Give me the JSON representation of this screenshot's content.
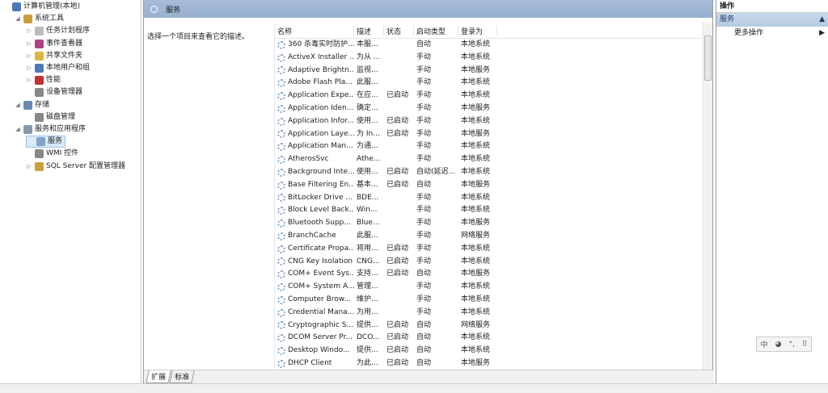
{
  "tree": [
    {
      "label": "计算机管理(本地)",
      "level": 0,
      "arrow": "",
      "color": "#4a7ab5"
    },
    {
      "label": "系统工具",
      "level": 1,
      "arrow": "◢",
      "color": "#c9a040"
    },
    {
      "label": "任务计划程序",
      "level": 2,
      "arrow": "▷",
      "color": "#bbbbbb"
    },
    {
      "label": "事件查看器",
      "level": 2,
      "arrow": "▷",
      "color": "#b04080"
    },
    {
      "label": "共享文件夹",
      "level": 2,
      "arrow": "▷",
      "color": "#d9b840"
    },
    {
      "label": "本地用户和组",
      "level": 2,
      "arrow": "▷",
      "color": "#4a7ab5"
    },
    {
      "label": "性能",
      "level": 2,
      "arrow": "▷",
      "color": "#c03030"
    },
    {
      "label": "设备管理器",
      "level": 2,
      "arrow": "",
      "color": "#888888"
    },
    {
      "label": "存储",
      "level": 1,
      "arrow": "◢",
      "color": "#6a8ab0"
    },
    {
      "label": "磁盘管理",
      "level": 2,
      "arrow": "",
      "color": "#888888"
    },
    {
      "label": "服务和应用程序",
      "level": 1,
      "arrow": "◢",
      "color": "#8899aa"
    },
    {
      "label": "服务",
      "level": 2,
      "arrow": "",
      "color": "#7fa5cc",
      "selected": true
    },
    {
      "label": "WMI 控件",
      "level": 2,
      "arrow": "",
      "color": "#888888"
    },
    {
      "label": "SQL Server 配置管理器",
      "level": 2,
      "arrow": "▷",
      "color": "#c9a040"
    }
  ],
  "middle": {
    "title": "服务",
    "description_hint": "选择一个项目来查看它的描述。",
    "columns": [
      "名称",
      "描述",
      "状态",
      "启动类型",
      "登录为"
    ],
    "rows": [
      [
        "360 杀毒实时防护...",
        "本服...",
        "",
        "自动",
        "本地系统"
      ],
      [
        "ActiveX Installer ...",
        "为从 ...",
        "",
        "手动",
        "本地系统"
      ],
      [
        "Adaptive Brightn...",
        "监视...",
        "",
        "手动",
        "本地服务"
      ],
      [
        "Adobe Flash Pla...",
        "此服...",
        "",
        "手动",
        "本地系统"
      ],
      [
        "Application Expe...",
        "在应...",
        "已启动",
        "手动",
        "本地系统"
      ],
      [
        "Application Iden...",
        "确定...",
        "",
        "手动",
        "本地服务"
      ],
      [
        "Application Infor...",
        "使用...",
        "已启动",
        "手动",
        "本地系统"
      ],
      [
        "Application Laye...",
        "为 In...",
        "已启动",
        "手动",
        "本地服务"
      ],
      [
        "Application Man...",
        "为通...",
        "",
        "手动",
        "本地系统"
      ],
      [
        "AtherosSvc",
        "Athe...",
        "",
        "手动",
        "本地系统"
      ],
      [
        "Background Inte...",
        "使用...",
        "已启动",
        "自动(延迟...",
        "本地系统"
      ],
      [
        "Base Filtering En...",
        "基本...",
        "已启动",
        "自动",
        "本地服务"
      ],
      [
        "BitLocker Drive ...",
        "BDE...",
        "",
        "手动",
        "本地系统"
      ],
      [
        "Block Level Back...",
        "Win...",
        "",
        "手动",
        "本地系统"
      ],
      [
        "Bluetooth Supp...",
        "Blue...",
        "",
        "手动",
        "本地服务"
      ],
      [
        "BranchCache",
        "此服...",
        "",
        "手动",
        "网络服务"
      ],
      [
        "Certificate Propa...",
        "将用...",
        "已启动",
        "手动",
        "本地系统"
      ],
      [
        "CNG Key Isolation",
        "CNG...",
        "已启动",
        "手动",
        "本地系统"
      ],
      [
        "COM+ Event Sys...",
        "支持...",
        "已启动",
        "自动",
        "本地服务"
      ],
      [
        "COM+ System A...",
        "管理...",
        "",
        "手动",
        "本地系统"
      ],
      [
        "Computer Brow...",
        "维护...",
        "",
        "手动",
        "本地系统"
      ],
      [
        "Credential Mana...",
        "为用...",
        "",
        "手动",
        "本地系统"
      ],
      [
        "Cryptographic S...",
        "提供...",
        "已启动",
        "自动",
        "网络服务"
      ],
      [
        "DCOM Server Pr...",
        "DCO...",
        "已启动",
        "自动",
        "本地系统"
      ],
      [
        "Desktop Windo...",
        "提供...",
        "已启动",
        "自动",
        "本地系统"
      ],
      [
        "DHCP Client",
        "为此...",
        "已启动",
        "自动",
        "本地服务"
      ]
    ],
    "tabs": [
      "扩展",
      "标准"
    ]
  },
  "right": {
    "title": "操作",
    "section": "服务",
    "item": "更多操作"
  },
  "ime": [
    "中",
    "◕",
    "°,",
    "⠿"
  ]
}
